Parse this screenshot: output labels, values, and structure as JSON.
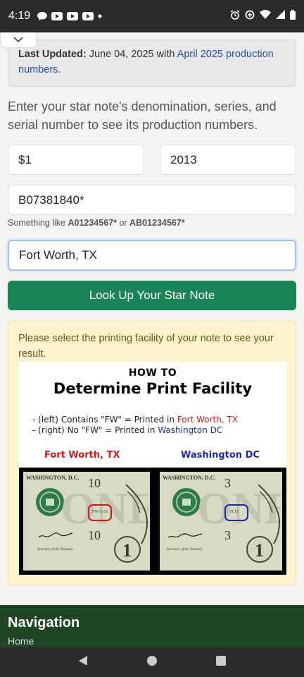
{
  "status_bar": {
    "time": "4:19",
    "left_icons": [
      "chat-bubble-icon",
      "youtube-icon",
      "youtube-icon",
      "youtube-icon",
      "dot-icon"
    ],
    "right_icons": [
      "alarm-icon",
      "data-saver-icon",
      "wifi-icon",
      "signal-icon",
      "battery-icon"
    ]
  },
  "notice": {
    "label": "Last Updated:",
    "text": " June 04, 2025 with ",
    "link": "April 2025 production numbers",
    "end": "."
  },
  "intro": "Enter your star note's denomination, series, and serial number to see its production numbers.",
  "form": {
    "denomination": "$1",
    "series": "2013",
    "serial": "B07381840*",
    "hint_prefix": "Something like ",
    "hint_example1": "A01234567*",
    "hint_or": " or ",
    "hint_example2": "AB01234567*",
    "facility": "Fort Worth, TX",
    "submit": "Look Up Your Star Note"
  },
  "alert": {
    "text": "Please select the printing facility of your note to see your result."
  },
  "infographic": {
    "how_to": "HOW TO",
    "title": "Determine Print Facility",
    "line1_pre": "- (left) Contains \"FW\" = Printed in ",
    "line1_place": "Fort Worth, TX",
    "line2_pre": "- (right) No \"FW\" = Printed in ",
    "line2_place": "Washington DC",
    "label_left": "Fort Worth, TX",
    "label_right": "Washington DC",
    "bill_left": {
      "city": "WASHINGTON, D.C.",
      "plate": "10",
      "mark": "FW G 65",
      "treasurer": "Secretary of the Treasury."
    },
    "bill_right": {
      "city": "WASHINGTON, D.C.",
      "plate": "3",
      "mark": "H 11",
      "treasurer": "Secretary of the Treasury."
    },
    "colors": {
      "red": "#d41616",
      "blue": "#1c2aa3"
    }
  },
  "footer": {
    "heading": "Navigation",
    "first_link": "Home"
  },
  "colors": {
    "accent_green": "#198554",
    "link_blue": "#1f4f9e",
    "footer_green": "#1f4624",
    "alert_bg": "#fdf3cf"
  }
}
